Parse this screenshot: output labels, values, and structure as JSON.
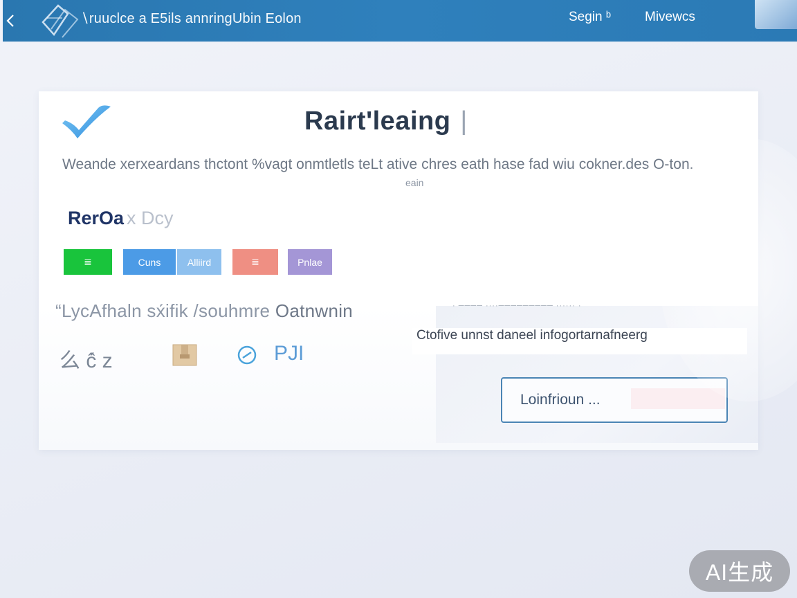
{
  "header": {
    "site_title": "∖ruuclce a E5ils annringUbin Eolon",
    "nav_signin": "Segin ᵇ",
    "nav_reviews": "Mivewcs",
    "nav_back_glyph": "‹"
  },
  "card": {
    "title": "Rairt'leaing",
    "title_caret": "|",
    "intro": "Weande xerxeardans thctont %vagt onmtletls teLt ative chres eath hase fad wiu cokner.des O‐ton.",
    "intro_tag": "eain",
    "section_title": "RerOa",
    "section_title_faded": "x Dcy",
    "buttons": {
      "green_glyph": "≣",
      "blue": "Cuns",
      "lightblue": "Alliird",
      "salmon_glyph": "≣",
      "purple": "Pnlae"
    },
    "tabs_line": {
      "part1": "“LycAfhaln sx́ifik",
      "part2": "/souhmre",
      "part3": "Oatnwnin"
    },
    "dots_line": "· ──── ····───────── ······ ·",
    "info_text": "Ctofive unnst daneel infogortarnafneerg",
    "icon_row": {
      "text1": "么 ĉ́ z",
      "text2": "PJI"
    },
    "cta_label": "Loinfrioun ..."
  },
  "watermark": "AI生成",
  "colors": {
    "header_blue": "#2f80bc",
    "green": "#19c43c",
    "blue": "#4c9be6",
    "lightblue": "#8ec0ee",
    "salmon": "#ef8f83",
    "purple": "#a496d6",
    "title_navy": "#1f3466"
  },
  "icons": {
    "logo": "diamond-logo-icon",
    "back": "chevron-left-icon",
    "check": "checkmark-logo-icon",
    "box": "package-box-icon",
    "ring": "circle-arrow-icon"
  }
}
